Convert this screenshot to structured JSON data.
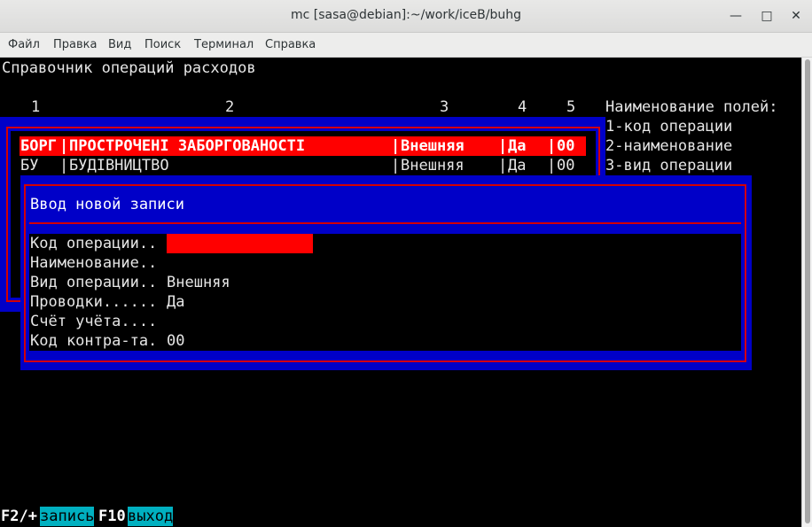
{
  "window": {
    "title": "mc [sasa@debian]:~/work/iceB/buhg",
    "minimize_glyph": "—",
    "maximize_glyph": "□",
    "close_glyph": "✕"
  },
  "menu": [
    "Файл",
    "Правка",
    "Вид",
    "Поиск",
    "Терминал",
    "Справка"
  ],
  "screen": {
    "header": "Справочник операций расходов",
    "column_numbers": [
      "1",
      "2",
      "3",
      "4",
      "5"
    ],
    "field_names_title": "Наименование полей:",
    "field_names": [
      "1-код операции",
      "2-наименование",
      "3-вид операции"
    ],
    "rows": [
      {
        "code": "БОРГ",
        "name": "ПРОСТРОЧЕНІ ЗАБОРГОВАНОСТІ",
        "kind": "Внешняя",
        "posting": "Да",
        "contr": "00",
        "selected": true
      },
      {
        "code": "БУ",
        "name": "БУДІВНИЦТВО",
        "kind": "Внешняя",
        "posting": "Да",
        "contr": "00",
        "selected": false
      }
    ],
    "separator": "|"
  },
  "dialog": {
    "title": "Ввод новой записи",
    "fields": [
      {
        "label": "Код операции..",
        "value": ""
      },
      {
        "label": "Наименование..",
        "value": ""
      },
      {
        "label": "Вид операции..",
        "value": "Внешняя"
      },
      {
        "label": "Проводки......",
        "value": "Да"
      },
      {
        "label": "Счёт учёта....",
        "value": ""
      },
      {
        "label": "Код контра-та.",
        "value": "00"
      }
    ]
  },
  "footer": {
    "key1": "F2/+",
    "action1": "запись",
    "key2": "F10",
    "action2": "выход"
  }
}
